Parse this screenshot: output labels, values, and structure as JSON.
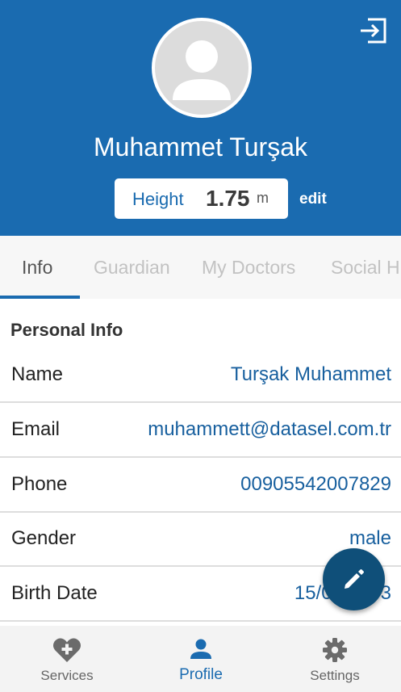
{
  "header": {
    "name": "Muhammet Turşak",
    "height_label": "Height",
    "height_value": "1.75",
    "height_unit": "m",
    "edit_label": "edit"
  },
  "tabs": [
    {
      "label": "Info",
      "active": true
    },
    {
      "label": "Guardian",
      "active": false
    },
    {
      "label": "My Doctors",
      "active": false
    },
    {
      "label": "Social H",
      "active": false
    }
  ],
  "personal_info": {
    "title": "Personal Info",
    "rows": [
      {
        "label": "Name",
        "value": "Turşak Muhammet"
      },
      {
        "label": "Email",
        "value": "muhammett@datasel.com.tr"
      },
      {
        "label": "Phone",
        "value": "00905542007829"
      },
      {
        "label": "Gender",
        "value": "male"
      },
      {
        "label": "Birth Date",
        "value": "15/07/1993"
      }
    ]
  },
  "bottom_nav": [
    {
      "label": "Services",
      "icon": "heart-plus-icon",
      "active": false
    },
    {
      "label": "Profile",
      "icon": "person-icon",
      "active": true
    },
    {
      "label": "Settings",
      "icon": "gear-icon",
      "active": false
    }
  ],
  "colors": {
    "primary": "#1a6bb0",
    "fab": "#0f4f79",
    "value_text": "#175f9e"
  }
}
